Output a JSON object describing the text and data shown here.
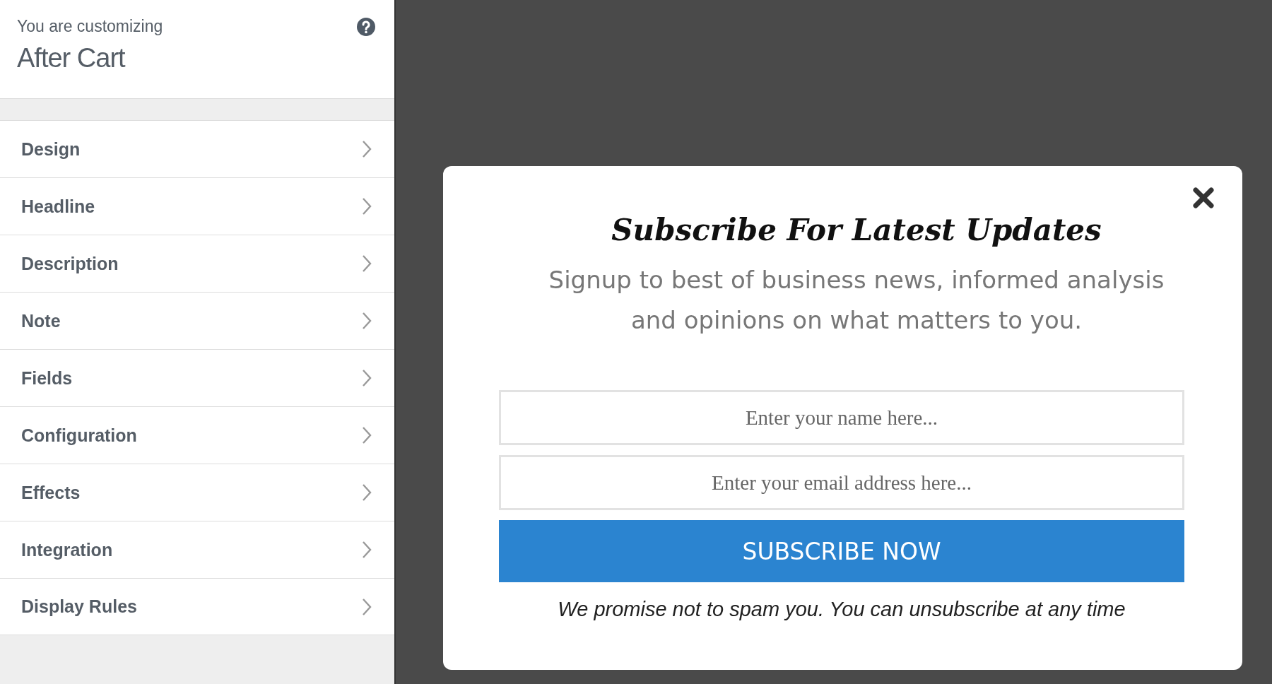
{
  "sidebar": {
    "caption": "You are customizing",
    "title": "After Cart",
    "items": [
      {
        "label": "Design"
      },
      {
        "label": "Headline"
      },
      {
        "label": "Description"
      },
      {
        "label": "Note"
      },
      {
        "label": "Fields"
      },
      {
        "label": "Configuration"
      },
      {
        "label": "Effects"
      },
      {
        "label": "Integration"
      },
      {
        "label": "Display Rules"
      }
    ]
  },
  "popup": {
    "title": "Subscribe For Latest Updates",
    "description": "Signup to best of business news, informed analysis and opinions on what matters to you.",
    "fields": [
      {
        "placeholder": "Enter your name here..."
      },
      {
        "placeholder": "Enter your email address here..."
      }
    ],
    "button": "SUBSCRIBE NOW",
    "footer": "We promise not to spam you. You can unsubscribe at any time"
  }
}
